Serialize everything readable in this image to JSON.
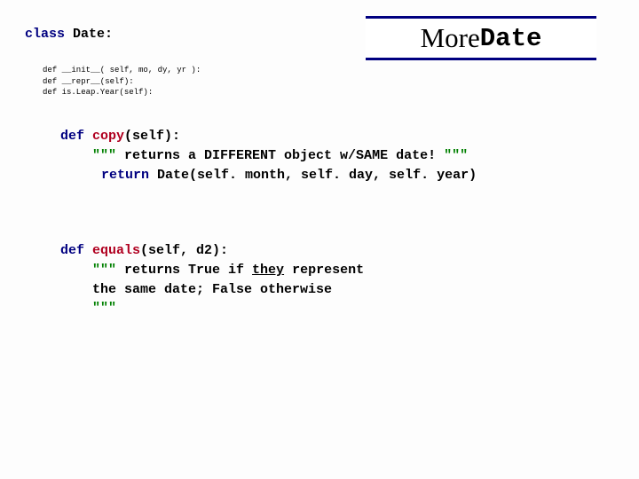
{
  "header": {
    "class_kw": "class",
    "class_name": "Date:"
  },
  "title": {
    "more": "More ",
    "date": "Date"
  },
  "small_defs": {
    "line1": "def __init__( self, mo, dy, yr ):",
    "line2": "def __repr__(self):",
    "line3": "def is.Leap.Year(self):"
  },
  "copy_block": {
    "def": "def",
    "sig_name": " copy",
    "sig_rest": "(self):",
    "doc_quotes": "\"\"\"",
    "doc_text": " returns a DIFFERENT object w/SAME date! ",
    "doc_endquotes": "\"\"\"",
    "return_kw": "return",
    "return_expr": " Date(self. month, self. day, self. year)"
  },
  "equals_block": {
    "def": "def",
    "sig_name": " equals",
    "sig_rest": "(self, d2):",
    "doc_quotes": "\"\"\"",
    "doc_text1_a": " returns True if ",
    "doc_text1_they": "they",
    "doc_text1_b": " represent",
    "doc_text2": "    the same date; False otherwise",
    "doc_endquotes": "\"\"\""
  }
}
